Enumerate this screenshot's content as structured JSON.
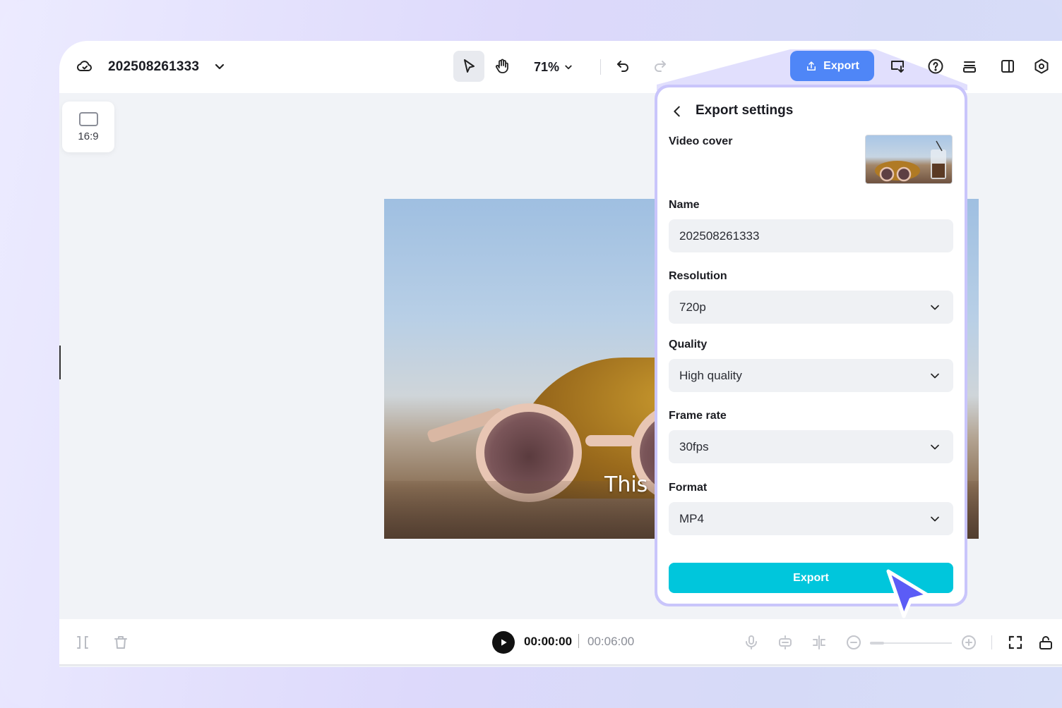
{
  "topbar": {
    "project_name": "202508261333",
    "zoom": "71%",
    "export_label": "Export",
    "icons": [
      "cloud-icon",
      "chevron-down-icon",
      "select-pointer-icon",
      "hand-icon",
      "undo-icon",
      "redo-icon",
      "upload-icon",
      "screen-download-icon",
      "help-icon",
      "layers-icon",
      "panel-layout-icon",
      "settings-icon"
    ]
  },
  "canvas": {
    "aspect_ratio": "16:9",
    "caption_text": "This i"
  },
  "timeline": {
    "current_time": "00:00:00",
    "total_time": "00:06:00"
  },
  "export_panel": {
    "title": "Export settings",
    "video_cover_label": "Video cover",
    "name_label": "Name",
    "name_value": "202508261333",
    "resolution_label": "Resolution",
    "resolution_value": "720p",
    "quality_label": "Quality",
    "quality_value": "High quality",
    "frame_rate_label": "Frame rate",
    "frame_rate_value": "30fps",
    "format_label": "Format",
    "format_value": "MP4",
    "export_button": "Export"
  },
  "colors": {
    "export_top_bg": "#4f86f7",
    "export_panel_button": "#00c6dc",
    "panel_glow": "#c9c5fb",
    "pointer": "#5b5cf6"
  }
}
